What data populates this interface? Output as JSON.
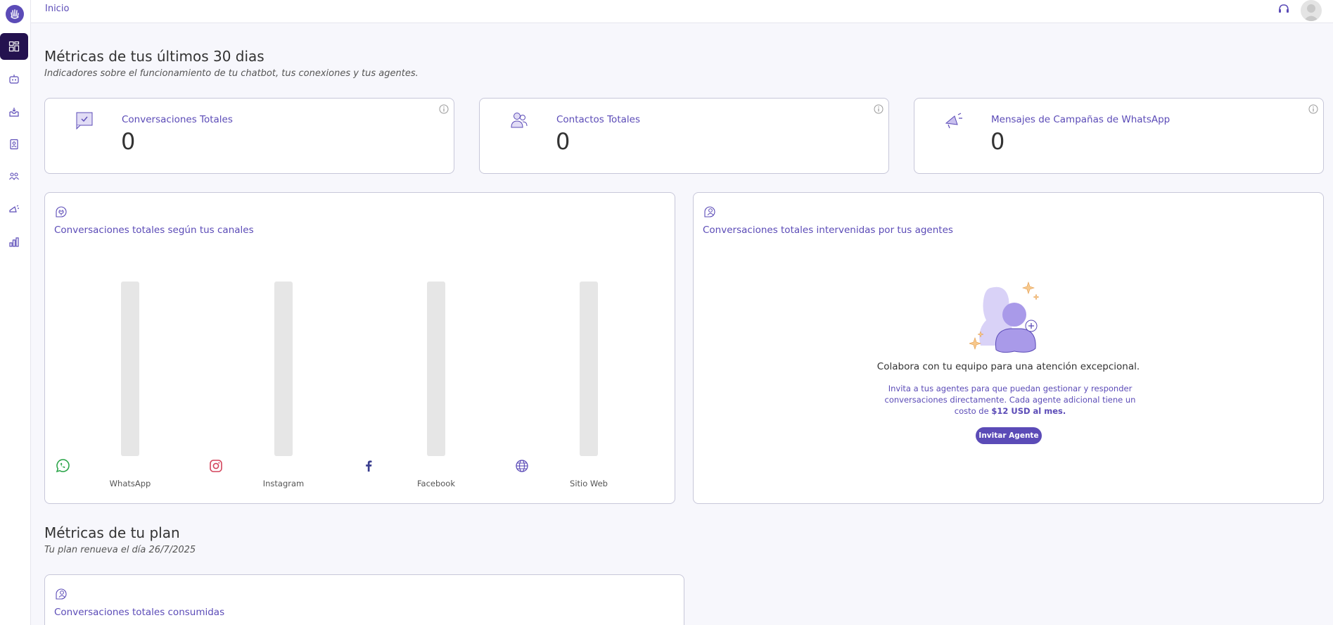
{
  "breadcrumb": "Inicio",
  "sidebar": {
    "logo_icon": "hand-logo-icon",
    "items": [
      {
        "name": "dashboard",
        "icon": "dashboard-icon",
        "active": true
      },
      {
        "name": "chatbot",
        "icon": "robot-icon",
        "active": false
      },
      {
        "name": "inbox",
        "icon": "inbox-icon",
        "active": false
      },
      {
        "name": "contacts",
        "icon": "contacts-book-icon",
        "active": false
      },
      {
        "name": "agents",
        "icon": "team-icon",
        "active": false
      },
      {
        "name": "campaigns",
        "icon": "megaphone-icon",
        "active": false
      },
      {
        "name": "metrics",
        "icon": "bar-chart-icon",
        "active": false
      }
    ]
  },
  "colors": {
    "accent": "#5b4bb7",
    "active_nav": "#24124f",
    "background": "#f7f7fc",
    "bar_track": "#e6e6e6",
    "whatsapp": "#25a244",
    "instagram": "#d3445c",
    "facebook": "#3b3f8f"
  },
  "metrics_section": {
    "title": "Métricas de tus últimos 30 dias",
    "subtitle": "Indicadores sobre el funcionamiento de tu chatbot, tus conexiones y tus agentes."
  },
  "metric_cards": [
    {
      "label": "Conversaciones Totales",
      "value": "0",
      "icon": "chat-check-icon"
    },
    {
      "label": "Contactos Totales",
      "value": "0",
      "icon": "users-icon"
    },
    {
      "label": "Mensajes de Campañas de WhatsApp",
      "value": "0",
      "icon": "megaphone-icon"
    }
  ],
  "channels_panel": {
    "title": "Conversaciones totales según tus canales",
    "icon": "plug-chat-icon",
    "channels": [
      {
        "label": "WhatsApp",
        "icon": "whatsapp-icon",
        "value": 0
      },
      {
        "label": "Instagram",
        "icon": "instagram-icon",
        "value": 0
      },
      {
        "label": "Facebook",
        "icon": "facebook-icon",
        "value": 0
      },
      {
        "label": "Sitio Web",
        "icon": "globe-icon",
        "value": 0
      }
    ]
  },
  "agents_panel": {
    "title": "Conversaciones totales intervenidas por tus agentes",
    "icon": "agent-chat-icon",
    "empty_title": "Colabora con tu equipo para una atención excepcional.",
    "empty_desc": "Invita a tus agentes para que puedan gestionar y responder conversaciones directamente. Cada agente adicional tiene un costo de ",
    "empty_price": "$12 USD al mes.",
    "invite_label": "Invitar Agente"
  },
  "plan_section": {
    "title": "Métricas de tu plan",
    "subtitle": "Tu plan renueva el día 26/7/2025"
  },
  "plan_panel": {
    "title": "Conversaciones totales consumidas",
    "icon": "agent-chat-icon"
  }
}
